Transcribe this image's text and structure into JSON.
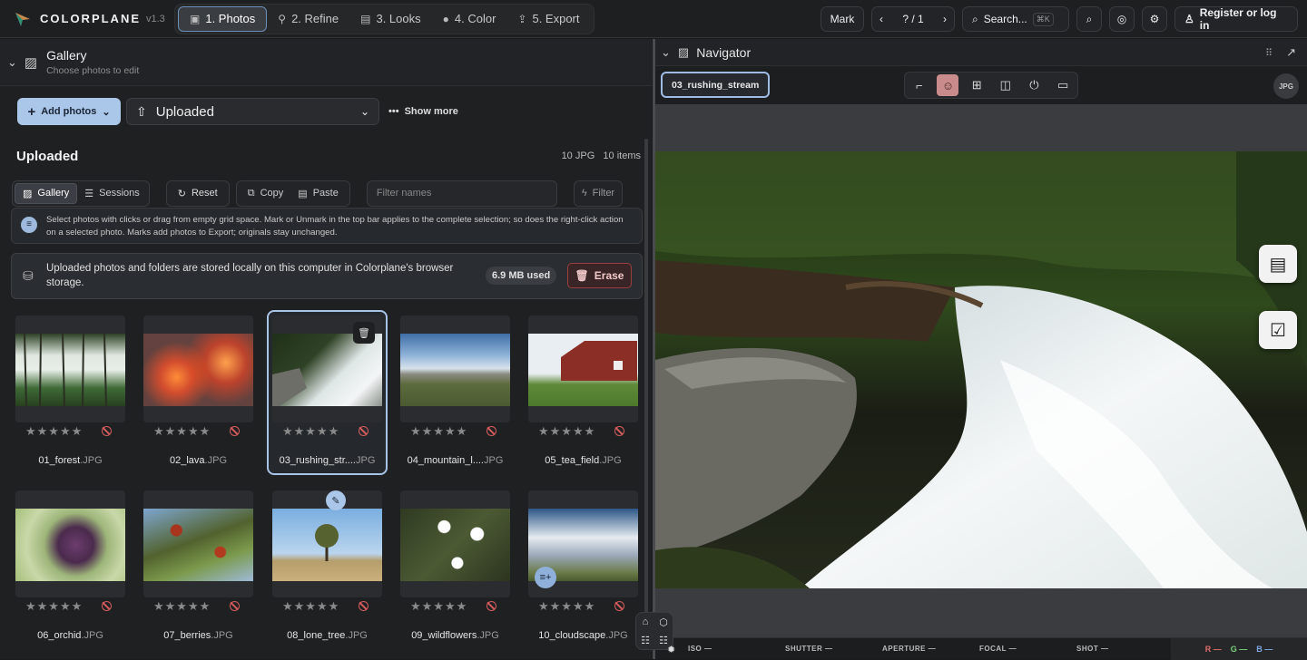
{
  "app": {
    "name": "COLORPLANE",
    "version": "v1.3"
  },
  "steps": [
    "1. Photos",
    "2. Refine",
    "3. Looks",
    "4. Color",
    "5. Export"
  ],
  "topbar": {
    "mark": "Mark",
    "counter": "? / 1",
    "search": "Search...",
    "search_kbd": "⌘K",
    "register": "Register or log in"
  },
  "gallery": {
    "title": "Gallery",
    "subtitle": "Choose photos to edit",
    "add": "Add photos",
    "source": "Uploaded",
    "show_more": "Show more",
    "heading": "Uploaded",
    "meta_types": "10 JPG",
    "meta_count": "10 items"
  },
  "toolbar": {
    "gallery": "Gallery",
    "sessions": "Sessions",
    "reset": "Reset",
    "copy": "Copy",
    "paste": "Paste",
    "filter_placeholder": "Filter names",
    "filter": "Filter"
  },
  "info": {
    "hint": "Select photos with clicks or drag from empty grid space. Mark or Unmark in the top bar applies to the complete selection; so does the right-click action on a selected photo. Marks add photos to Export; originals stay unchanged.",
    "storage": "Uploaded photos and folders are stored locally on this computer in Colorplane's browser storage.",
    "used": "6.9 MB used",
    "erase": "Erase"
  },
  "photos": [
    {
      "base": "01_forest",
      "ext": ".JPG"
    },
    {
      "base": "02_lava",
      "ext": ".JPG"
    },
    {
      "base": "03_rushing_str....",
      "ext": "JPG",
      "selected": true
    },
    {
      "base": "04_mountain_l....",
      "ext": "JPG"
    },
    {
      "base": "05_tea_field",
      "ext": ".JPG"
    },
    {
      "base": "06_orchid",
      "ext": ".JPG"
    },
    {
      "base": "07_berries",
      "ext": ".JPG"
    },
    {
      "base": "08_lone_tree",
      "ext": ".JPG"
    },
    {
      "base": "09_wildflowers",
      "ext": ".JPG"
    },
    {
      "base": "10_cloudscape",
      "ext": ".JPG"
    }
  ],
  "navigator": {
    "title": "Navigator",
    "file": "03_rushing_stream",
    "badge": "JPG"
  },
  "exif": {
    "iso": "ISO —",
    "shutter": "SHUTTER —",
    "aperture": "APERTURE —",
    "focal": "FOCAL —",
    "shot": "SHOT —",
    "r": "R —",
    "g": "G —",
    "b": "B —"
  },
  "colors": {
    "accent": "#a7c3e6",
    "reject": "#d65c5c"
  }
}
